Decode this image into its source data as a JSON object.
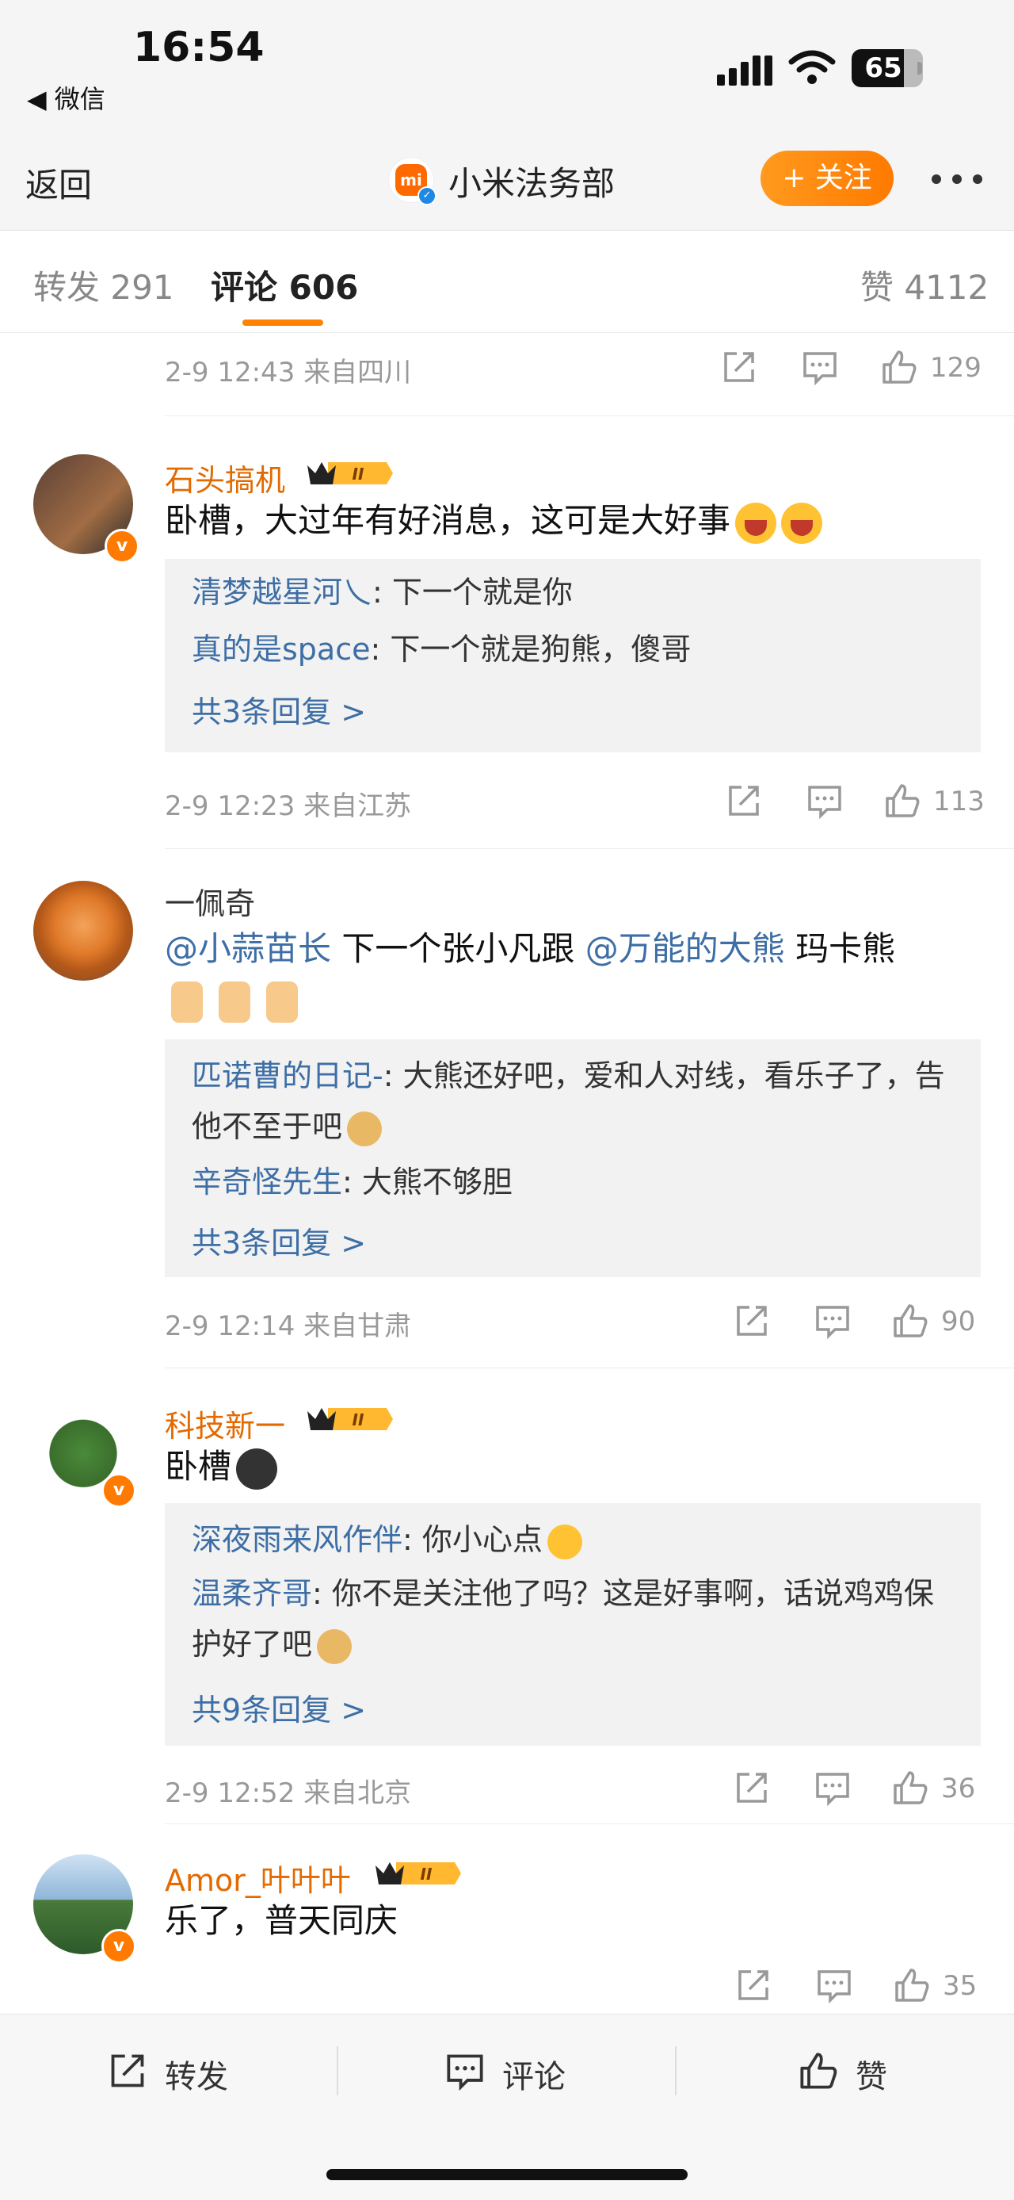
{
  "status_bar": {
    "time": "16:54",
    "back_app": "◀ 微信",
    "battery": "65"
  },
  "nav": {
    "back_label": "返回",
    "logo_text": "mi",
    "title": "小米法务部",
    "follow_label": "+ 关注"
  },
  "tabs": {
    "repost": "转发 291",
    "comment": "评论 606",
    "like": "赞 4112"
  },
  "first_meta": {
    "meta": "2-9 12:43 来自四川",
    "likes": "129"
  },
  "comments": [
    {
      "username": "石头搞机",
      "badge": "II",
      "text": "卧槽，大过年有好消息，这可是大好事",
      "replies": [
        {
          "name": "清梦越星河乀",
          "text": ": 下一个就是你"
        },
        {
          "name": "真的是space",
          "text": ": 下一个就是狗熊，傻哥"
        }
      ],
      "more": "共3条回复 >",
      "meta": "2-9 12:23 来自江苏",
      "likes": "113"
    },
    {
      "username": "一佩奇",
      "mention1": "@小蒜苗长",
      "mid": " 下一个张小凡跟 ",
      "mention2": "@万能的大熊",
      "tail": " 玛卡熊",
      "replies": [
        {
          "name": "匹诺曹的日记-",
          "text": ": 大熊还好吧，爱和人对线，看乐子了，告他不至于吧"
        },
        {
          "name": "辛奇怪先生",
          "text": ": 大熊不够胆"
        }
      ],
      "more": "共3条回复 >",
      "meta": "2-9 12:14 来自甘肃",
      "likes": "90"
    },
    {
      "username": "科技新一",
      "badge": "II",
      "text": "卧槽",
      "replies": [
        {
          "name": "深夜雨来风作伴",
          "text": ": 你小心点"
        },
        {
          "name": "温柔齐哥",
          "text": ": 你不是关注他了吗？这是好事啊，话说鸡鸡保护好了吧"
        }
      ],
      "more": "共9条回复 >",
      "meta": "2-9 12:52 来自北京",
      "likes": "36"
    },
    {
      "username": "Amor_叶叶叶",
      "badge": "II",
      "text": "乐了，普天同庆",
      "likes": "35"
    }
  ],
  "bottom_bar": {
    "repost": "转发",
    "comment": "评论",
    "like": "赞"
  },
  "colors": {
    "accent": "#ff8200",
    "username": "#e26a00",
    "link": "#3d6ea5"
  }
}
